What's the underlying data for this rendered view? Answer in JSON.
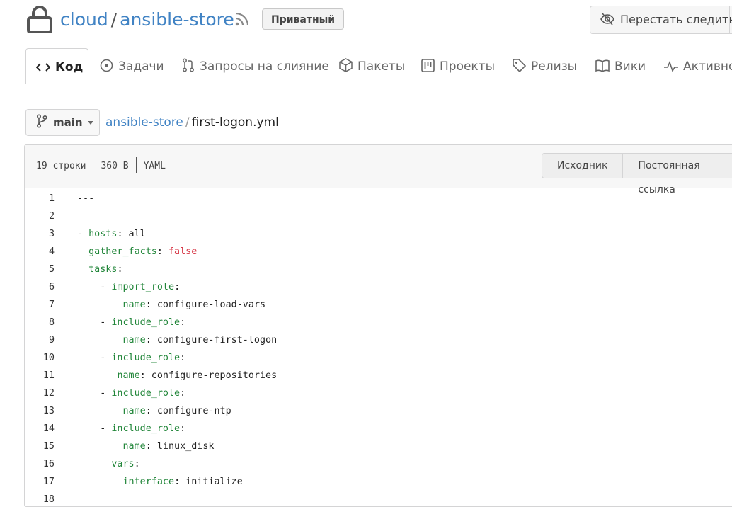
{
  "repo": {
    "owner": "cloud",
    "separator": "/",
    "name": "ansible-store",
    "visibility_badge": "Приватный",
    "watch_label": "Перестать следить"
  },
  "tabs": [
    {
      "label": "Код",
      "icon": "code-icon",
      "active": true
    },
    {
      "label": "Задачи",
      "icon": "issue-icon"
    },
    {
      "label": "Запросы на слияние",
      "icon": "pull-request-icon"
    },
    {
      "label": "Пакеты",
      "icon": "package-icon"
    },
    {
      "label": "Проекты",
      "icon": "project-icon"
    },
    {
      "label": "Релизы",
      "icon": "tag-icon"
    },
    {
      "label": "Вики",
      "icon": "book-icon"
    },
    {
      "label": "Активность",
      "icon": "pulse-icon"
    }
  ],
  "branch": {
    "name": "main"
  },
  "breadcrumb": {
    "repo": "ansible-store",
    "separator": "/",
    "file": "first-logon.yml"
  },
  "file": {
    "lines_count": "19 строки",
    "size": "360 B",
    "language": "YAML",
    "raw_button": "Исходник",
    "permalink_button": "Постоянная ссылка"
  },
  "code_lines": [
    {
      "n": "1",
      "tokens": [
        {
          "t": "---",
          "c": ""
        }
      ]
    },
    {
      "n": "2",
      "tokens": []
    },
    {
      "n": "3",
      "tokens": [
        {
          "t": "- ",
          "c": ""
        },
        {
          "t": "hosts",
          "c": "k"
        },
        {
          "t": ": all",
          "c": ""
        }
      ]
    },
    {
      "n": "4",
      "tokens": [
        {
          "t": "  ",
          "c": ""
        },
        {
          "t": "gather_facts",
          "c": "k"
        },
        {
          "t": ": ",
          "c": ""
        },
        {
          "t": "false",
          "c": "v"
        }
      ]
    },
    {
      "n": "5",
      "tokens": [
        {
          "t": "  ",
          "c": ""
        },
        {
          "t": "tasks",
          "c": "k"
        },
        {
          "t": ":",
          "c": ""
        }
      ]
    },
    {
      "n": "6",
      "tokens": [
        {
          "t": "    - ",
          "c": ""
        },
        {
          "t": "import_role",
          "c": "k"
        },
        {
          "t": ":",
          "c": ""
        }
      ]
    },
    {
      "n": "7",
      "tokens": [
        {
          "t": "        ",
          "c": ""
        },
        {
          "t": "name",
          "c": "k"
        },
        {
          "t": ": configure-load-vars",
          "c": ""
        }
      ]
    },
    {
      "n": "8",
      "tokens": [
        {
          "t": "    - ",
          "c": ""
        },
        {
          "t": "include_role",
          "c": "k"
        },
        {
          "t": ":",
          "c": ""
        }
      ]
    },
    {
      "n": "9",
      "tokens": [
        {
          "t": "        ",
          "c": ""
        },
        {
          "t": "name",
          "c": "k"
        },
        {
          "t": ": configure-first-logon",
          "c": ""
        }
      ]
    },
    {
      "n": "10",
      "tokens": [
        {
          "t": "    - ",
          "c": ""
        },
        {
          "t": "include_role",
          "c": "k"
        },
        {
          "t": ":",
          "c": ""
        }
      ]
    },
    {
      "n": "11",
      "tokens": [
        {
          "t": "       ",
          "c": ""
        },
        {
          "t": "name",
          "c": "k"
        },
        {
          "t": ": configure-repositories",
          "c": ""
        }
      ]
    },
    {
      "n": "12",
      "tokens": [
        {
          "t": "    - ",
          "c": ""
        },
        {
          "t": "include_role",
          "c": "k"
        },
        {
          "t": ":",
          "c": ""
        }
      ]
    },
    {
      "n": "13",
      "tokens": [
        {
          "t": "        ",
          "c": ""
        },
        {
          "t": "name",
          "c": "k"
        },
        {
          "t": ": configure-ntp",
          "c": ""
        }
      ]
    },
    {
      "n": "14",
      "tokens": [
        {
          "t": "    - ",
          "c": ""
        },
        {
          "t": "include_role",
          "c": "k"
        },
        {
          "t": ":",
          "c": ""
        }
      ]
    },
    {
      "n": "15",
      "tokens": [
        {
          "t": "        ",
          "c": ""
        },
        {
          "t": "name",
          "c": "k"
        },
        {
          "t": ": linux_disk",
          "c": ""
        }
      ]
    },
    {
      "n": "16",
      "tokens": [
        {
          "t": "      ",
          "c": ""
        },
        {
          "t": "vars",
          "c": "k"
        },
        {
          "t": ":",
          "c": ""
        }
      ]
    },
    {
      "n": "17",
      "tokens": [
        {
          "t": "        ",
          "c": ""
        },
        {
          "t": "interface",
          "c": "k"
        },
        {
          "t": ": initialize",
          "c": ""
        }
      ]
    },
    {
      "n": "18",
      "tokens": []
    }
  ],
  "colors": {
    "link": "#4183c4",
    "yaml_key": "#22863a",
    "yaml_value": "#d73a49"
  }
}
